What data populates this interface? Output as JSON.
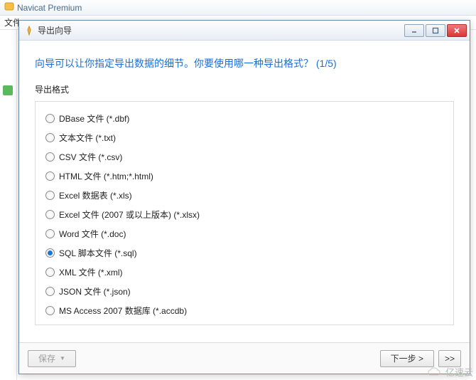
{
  "app": {
    "title": "Navicat Premium"
  },
  "menubar": {
    "file": "文件"
  },
  "dialog": {
    "title": "导出向导",
    "heading": "向导可以让你指定导出数据的细节。你要使用哪一种导出格式？ (1/5)",
    "group_label": "导出格式",
    "options": [
      {
        "label": "DBase 文件 (*.dbf)",
        "checked": false
      },
      {
        "label": "文本文件 (*.txt)",
        "checked": false
      },
      {
        "label": "CSV 文件 (*.csv)",
        "checked": false
      },
      {
        "label": "HTML 文件 (*.htm;*.html)",
        "checked": false
      },
      {
        "label": "Excel 数据表 (*.xls)",
        "checked": false
      },
      {
        "label": "Excel 文件 (2007 或以上版本) (*.xlsx)",
        "checked": false
      },
      {
        "label": "Word 文件 (*.doc)",
        "checked": false
      },
      {
        "label": "SQL 脚本文件 (*.sql)",
        "checked": true
      },
      {
        "label": "XML 文件 (*.xml)",
        "checked": false
      },
      {
        "label": "JSON 文件 (*.json)",
        "checked": false
      },
      {
        "label": "MS Access 2007 数据库 (*.accdb)",
        "checked": false
      }
    ],
    "buttons": {
      "save": "保存",
      "next": "下一步 >",
      "last": ">>"
    }
  },
  "watermark": "亿速云"
}
